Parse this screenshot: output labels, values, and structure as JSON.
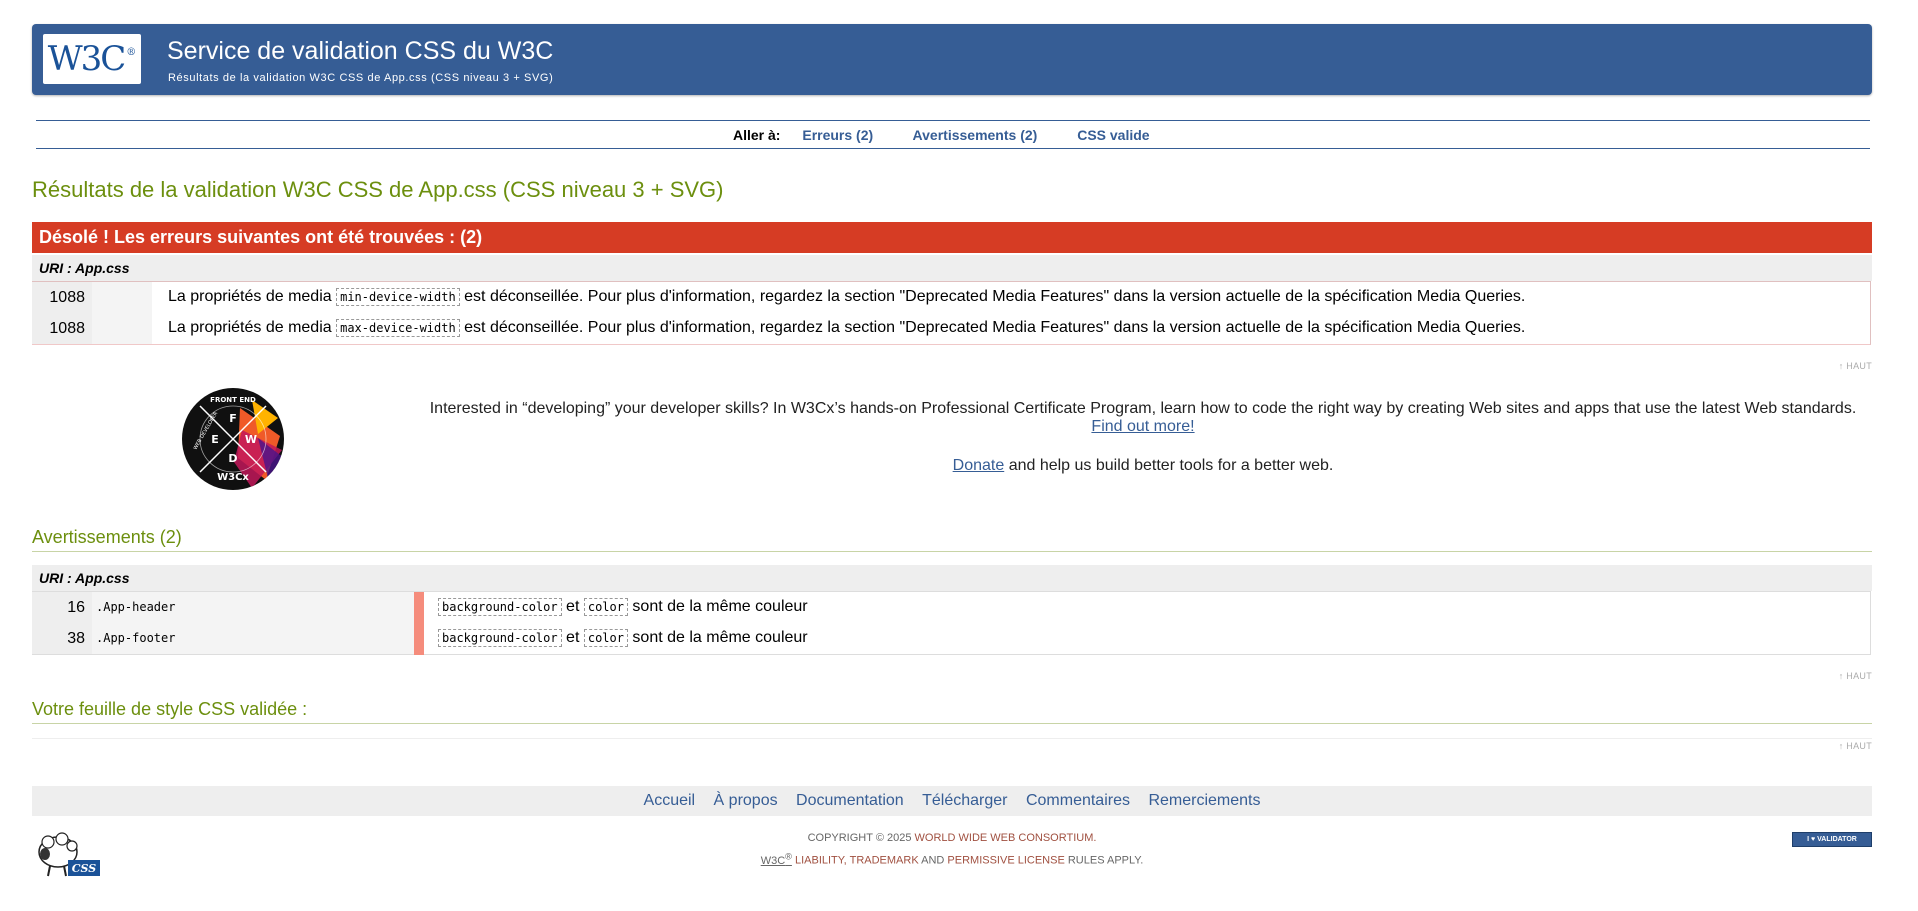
{
  "banner": {
    "logo_text": "W3C",
    "logo_reg": "®",
    "title": "Service de validation CSS du W3C",
    "subtitle": "Résultats de la validation W3C CSS de App.css (CSS niveau 3 + SVG)"
  },
  "jump": {
    "label": "Aller à:",
    "links": [
      "Erreurs (2)",
      "Avertissements (2)",
      "CSS valide"
    ]
  },
  "results_title": "Résultats de la validation W3C CSS de App.css (CSS niveau 3 + SVG)",
  "errors": {
    "header": "Désolé ! Les erreurs suivantes ont été trouvées : (2)",
    "uri": "URI : App.css",
    "rows": [
      {
        "line": "1088",
        "prefix": "La propriétés de media",
        "code": "min-device-width",
        "suffix": "est déconseillée. Pour plus d'information, regardez la section \"Deprecated Media Features\" dans la version actuelle de la spécification Media Queries."
      },
      {
        "line": "1088",
        "prefix": "La propriétés de media",
        "code": "max-device-width",
        "suffix": "est déconseillée. Pour plus d'information, regardez la section \"Deprecated Media Features\" dans la version actuelle de la spécification Media Queries."
      }
    ]
  },
  "top_link": "↑ HAUT",
  "promo": {
    "text": "Interested in “developing” your developer skills? In W3Cx’s hands-on Professional Certificate Program, learn how to code the right way by creating Web sites and apps that use the latest Web standards.",
    "find_out": "Find out more!",
    "donate": "Donate",
    "donate_suffix": "and help us build better tools for a better web.",
    "badge_top": "FRONT END",
    "badge_bottom": "WEB DEVELOPER",
    "badge_letters": [
      "F",
      "E",
      "W",
      "D"
    ],
    "badge_brand": "W3Cx"
  },
  "warnings": {
    "title": "Avertissements (2)",
    "uri": "URI : App.css",
    "rows": [
      {
        "line": "16",
        "context": ".App-header",
        "code1": "background-color",
        "mid": "et",
        "code2": "color",
        "suffix": "sont de la même couleur"
      },
      {
        "line": "38",
        "context": ".App-footer",
        "code1": "background-color",
        "mid": "et",
        "code2": "color",
        "suffix": "sont de la même couleur"
      }
    ]
  },
  "validated_title": "Votre feuille de style CSS validée :",
  "footer": {
    "nav": [
      "Accueil",
      "À propos",
      "Documentation",
      "Télécharger",
      "Commentaires",
      "Remerciements"
    ],
    "copyright_prefix": "COPYRIGHT © 2025",
    "consortium": "WORLD WIDE WEB CONSORTIUM.",
    "w3c": "W3C",
    "w3c_reg": "®",
    "liability": "LIABILITY,",
    "trademark": "TRADEMARK",
    "and": "AND",
    "license": "PERMISSIVE LICENSE",
    "rules": "RULES APPLY.",
    "sheep_label": "CSS",
    "validator_button": "I ♥ VALIDATOR"
  },
  "colors": {
    "banner": "#365d95",
    "error": "#d63c24",
    "heading": "#6c8f0e",
    "warning_bar": "#f58c7c"
  }
}
